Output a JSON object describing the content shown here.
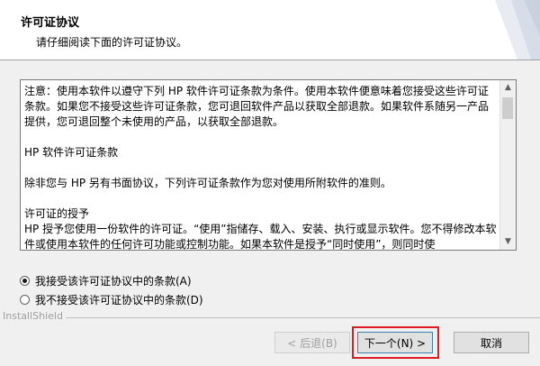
{
  "header": {
    "title": "许可证协议",
    "subtitle": "请仔细阅读下面的许可证协议。"
  },
  "license": {
    "paragraphs": [
      "注意：使用本软件以遵守下列 HP 软件许可证条款为条件。使用本软件便意味着您接受这些许可证条款。如果您不接受这些许可证条款，您可退回软件产品以获取全部退款。如果软件系随另一产品提供，您可退回整个未使用的产品，以获取全部退款。",
      "HP 软件许可证条款",
      "除非您与 HP 另有书面协议，下列许可证条款作为您对使用所附软件的准则。",
      "许可证的授予",
      "HP 授予您使用一份软件的许可证。“使用”指储存、载入、安装、执行或显示软件。您不得修改本软件或使用本软件的任何许可功能或控制功能。如果本软件是授予“同时使用”，则同时使"
    ]
  },
  "options": {
    "accept": "我接受该许可证协议中的条款(A)",
    "decline": "我不接受该许可证协议中的条款(D)",
    "selected": "accept"
  },
  "footer": {
    "brand": "InstallShield",
    "back_label": "< 后退(B)",
    "next_label": "下一个(N) >",
    "cancel_label": "取消"
  },
  "colors": {
    "highlight": "#e01b22",
    "header_bg": "#ffffff",
    "dialog_bg": "#f0f0f0"
  }
}
